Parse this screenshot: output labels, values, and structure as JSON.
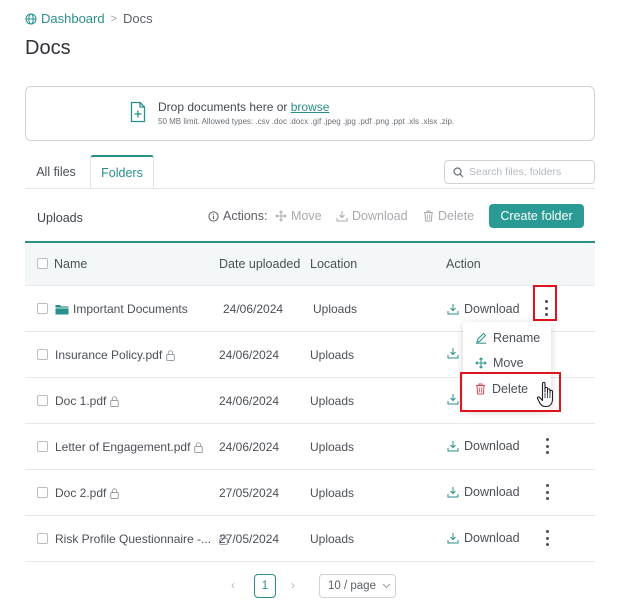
{
  "breadcrumb": {
    "home": "Dashboard",
    "separator": ">",
    "current": "Docs"
  },
  "page_title": "Docs",
  "dropzone": {
    "text": "Drop documents here or",
    "link": "browse",
    "hint": "50 MB limit. Allowed types: .csv .doc .docx .gif .jpeg .jpg .pdf .png .ppt .xls .xlsx .zip."
  },
  "tabs": [
    {
      "label": "All files"
    },
    {
      "label": "Folders"
    }
  ],
  "active_tab": "Folders",
  "search": {
    "placeholder": "Search files, folders",
    "value": ""
  },
  "toolbar": {
    "path": "Uploads",
    "actions_label": "Actions:",
    "move": "Move",
    "download": "Download",
    "delete": "Delete",
    "create_folder": "Create folder"
  },
  "table": {
    "columns": [
      "Name",
      "Date uploaded",
      "Location",
      "Action"
    ],
    "rows": [
      {
        "name": "Important Documents",
        "type": "folder",
        "locked": false,
        "date": "24/06/2024",
        "location": "Uploads",
        "action": "Download"
      },
      {
        "name": "Insurance Policy.pdf",
        "type": "file",
        "locked": true,
        "date": "24/06/2024",
        "location": "Uploads",
        "action": ""
      },
      {
        "name": "Doc 1.pdf",
        "type": "file",
        "locked": true,
        "date": "24/06/2024",
        "location": "Uploads",
        "action": ""
      },
      {
        "name": "Letter of Engagement.pdf",
        "type": "file",
        "locked": true,
        "date": "24/06/2024",
        "location": "Uploads",
        "action": "Download"
      },
      {
        "name": "Doc 2.pdf",
        "type": "file",
        "locked": true,
        "date": "27/05/2024",
        "location": "Uploads",
        "action": "Download"
      },
      {
        "name": "Risk Profile Questionnaire -...",
        "type": "file",
        "locked": true,
        "date": "27/05/2024",
        "location": "Uploads",
        "action": "Download"
      }
    ]
  },
  "context_menu": {
    "items": [
      "Rename",
      "Move",
      "Delete"
    ]
  },
  "pagination": {
    "current_page": "1",
    "page_size": "10 / page"
  },
  "colors": {
    "accent": "#2a9a94",
    "highlight": "#e0141e",
    "delete": "#e0445a"
  },
  "icons": [
    "globe-icon",
    "file-plus-icon",
    "search-icon",
    "info-icon",
    "move-icon",
    "download-icon",
    "trash-icon",
    "folder-icon",
    "lock-icon",
    "kebab-icon",
    "edit-icon",
    "hand-cursor-icon",
    "chevron-left-icon",
    "chevron-right-icon",
    "chevron-down-icon"
  ]
}
